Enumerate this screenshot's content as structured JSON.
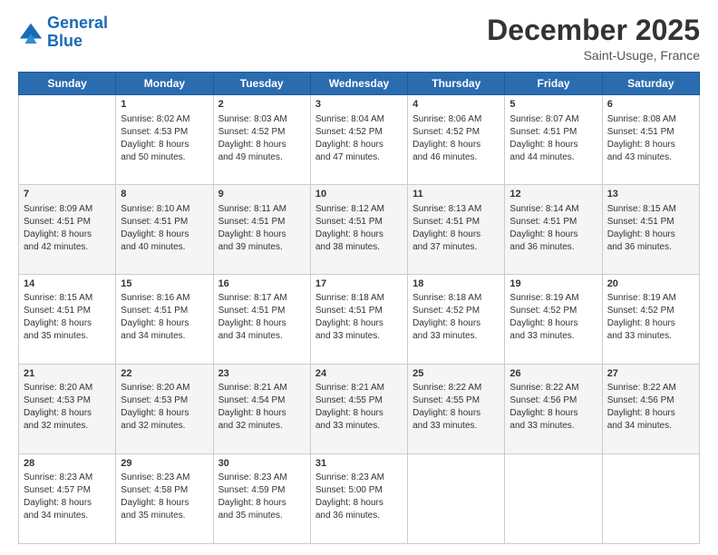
{
  "header": {
    "logo": {
      "line1": "General",
      "line2": "Blue"
    },
    "title": "December 2025",
    "location": "Saint-Usuge, France"
  },
  "weekdays": [
    "Sunday",
    "Monday",
    "Tuesday",
    "Wednesday",
    "Thursday",
    "Friday",
    "Saturday"
  ],
  "weeks": [
    [
      {
        "day": null,
        "sunrise": null,
        "sunset": null,
        "daylight": null
      },
      {
        "day": "1",
        "sunrise": "Sunrise: 8:02 AM",
        "sunset": "Sunset: 4:53 PM",
        "daylight": "Daylight: 8 hours and 50 minutes."
      },
      {
        "day": "2",
        "sunrise": "Sunrise: 8:03 AM",
        "sunset": "Sunset: 4:52 PM",
        "daylight": "Daylight: 8 hours and 49 minutes."
      },
      {
        "day": "3",
        "sunrise": "Sunrise: 8:04 AM",
        "sunset": "Sunset: 4:52 PM",
        "daylight": "Daylight: 8 hours and 47 minutes."
      },
      {
        "day": "4",
        "sunrise": "Sunrise: 8:06 AM",
        "sunset": "Sunset: 4:52 PM",
        "daylight": "Daylight: 8 hours and 46 minutes."
      },
      {
        "day": "5",
        "sunrise": "Sunrise: 8:07 AM",
        "sunset": "Sunset: 4:51 PM",
        "daylight": "Daylight: 8 hours and 44 minutes."
      },
      {
        "day": "6",
        "sunrise": "Sunrise: 8:08 AM",
        "sunset": "Sunset: 4:51 PM",
        "daylight": "Daylight: 8 hours and 43 minutes."
      }
    ],
    [
      {
        "day": "7",
        "sunrise": "Sunrise: 8:09 AM",
        "sunset": "Sunset: 4:51 PM",
        "daylight": "Daylight: 8 hours and 42 minutes."
      },
      {
        "day": "8",
        "sunrise": "Sunrise: 8:10 AM",
        "sunset": "Sunset: 4:51 PM",
        "daylight": "Daylight: 8 hours and 40 minutes."
      },
      {
        "day": "9",
        "sunrise": "Sunrise: 8:11 AM",
        "sunset": "Sunset: 4:51 PM",
        "daylight": "Daylight: 8 hours and 39 minutes."
      },
      {
        "day": "10",
        "sunrise": "Sunrise: 8:12 AM",
        "sunset": "Sunset: 4:51 PM",
        "daylight": "Daylight: 8 hours and 38 minutes."
      },
      {
        "day": "11",
        "sunrise": "Sunrise: 8:13 AM",
        "sunset": "Sunset: 4:51 PM",
        "daylight": "Daylight: 8 hours and 37 minutes."
      },
      {
        "day": "12",
        "sunrise": "Sunrise: 8:14 AM",
        "sunset": "Sunset: 4:51 PM",
        "daylight": "Daylight: 8 hours and 36 minutes."
      },
      {
        "day": "13",
        "sunrise": "Sunrise: 8:15 AM",
        "sunset": "Sunset: 4:51 PM",
        "daylight": "Daylight: 8 hours and 36 minutes."
      }
    ],
    [
      {
        "day": "14",
        "sunrise": "Sunrise: 8:15 AM",
        "sunset": "Sunset: 4:51 PM",
        "daylight": "Daylight: 8 hours and 35 minutes."
      },
      {
        "day": "15",
        "sunrise": "Sunrise: 8:16 AM",
        "sunset": "Sunset: 4:51 PM",
        "daylight": "Daylight: 8 hours and 34 minutes."
      },
      {
        "day": "16",
        "sunrise": "Sunrise: 8:17 AM",
        "sunset": "Sunset: 4:51 PM",
        "daylight": "Daylight: 8 hours and 34 minutes."
      },
      {
        "day": "17",
        "sunrise": "Sunrise: 8:18 AM",
        "sunset": "Sunset: 4:51 PM",
        "daylight": "Daylight: 8 hours and 33 minutes."
      },
      {
        "day": "18",
        "sunrise": "Sunrise: 8:18 AM",
        "sunset": "Sunset: 4:52 PM",
        "daylight": "Daylight: 8 hours and 33 minutes."
      },
      {
        "day": "19",
        "sunrise": "Sunrise: 8:19 AM",
        "sunset": "Sunset: 4:52 PM",
        "daylight": "Daylight: 8 hours and 33 minutes."
      },
      {
        "day": "20",
        "sunrise": "Sunrise: 8:19 AM",
        "sunset": "Sunset: 4:52 PM",
        "daylight": "Daylight: 8 hours and 33 minutes."
      }
    ],
    [
      {
        "day": "21",
        "sunrise": "Sunrise: 8:20 AM",
        "sunset": "Sunset: 4:53 PM",
        "daylight": "Daylight: 8 hours and 32 minutes."
      },
      {
        "day": "22",
        "sunrise": "Sunrise: 8:20 AM",
        "sunset": "Sunset: 4:53 PM",
        "daylight": "Daylight: 8 hours and 32 minutes."
      },
      {
        "day": "23",
        "sunrise": "Sunrise: 8:21 AM",
        "sunset": "Sunset: 4:54 PM",
        "daylight": "Daylight: 8 hours and 32 minutes."
      },
      {
        "day": "24",
        "sunrise": "Sunrise: 8:21 AM",
        "sunset": "Sunset: 4:55 PM",
        "daylight": "Daylight: 8 hours and 33 minutes."
      },
      {
        "day": "25",
        "sunrise": "Sunrise: 8:22 AM",
        "sunset": "Sunset: 4:55 PM",
        "daylight": "Daylight: 8 hours and 33 minutes."
      },
      {
        "day": "26",
        "sunrise": "Sunrise: 8:22 AM",
        "sunset": "Sunset: 4:56 PM",
        "daylight": "Daylight: 8 hours and 33 minutes."
      },
      {
        "day": "27",
        "sunrise": "Sunrise: 8:22 AM",
        "sunset": "Sunset: 4:56 PM",
        "daylight": "Daylight: 8 hours and 34 minutes."
      }
    ],
    [
      {
        "day": "28",
        "sunrise": "Sunrise: 8:23 AM",
        "sunset": "Sunset: 4:57 PM",
        "daylight": "Daylight: 8 hours and 34 minutes."
      },
      {
        "day": "29",
        "sunrise": "Sunrise: 8:23 AM",
        "sunset": "Sunset: 4:58 PM",
        "daylight": "Daylight: 8 hours and 35 minutes."
      },
      {
        "day": "30",
        "sunrise": "Sunrise: 8:23 AM",
        "sunset": "Sunset: 4:59 PM",
        "daylight": "Daylight: 8 hours and 35 minutes."
      },
      {
        "day": "31",
        "sunrise": "Sunrise: 8:23 AM",
        "sunset": "Sunset: 5:00 PM",
        "daylight": "Daylight: 8 hours and 36 minutes."
      },
      {
        "day": null,
        "sunrise": null,
        "sunset": null,
        "daylight": null
      },
      {
        "day": null,
        "sunrise": null,
        "sunset": null,
        "daylight": null
      },
      {
        "day": null,
        "sunrise": null,
        "sunset": null,
        "daylight": null
      }
    ]
  ]
}
